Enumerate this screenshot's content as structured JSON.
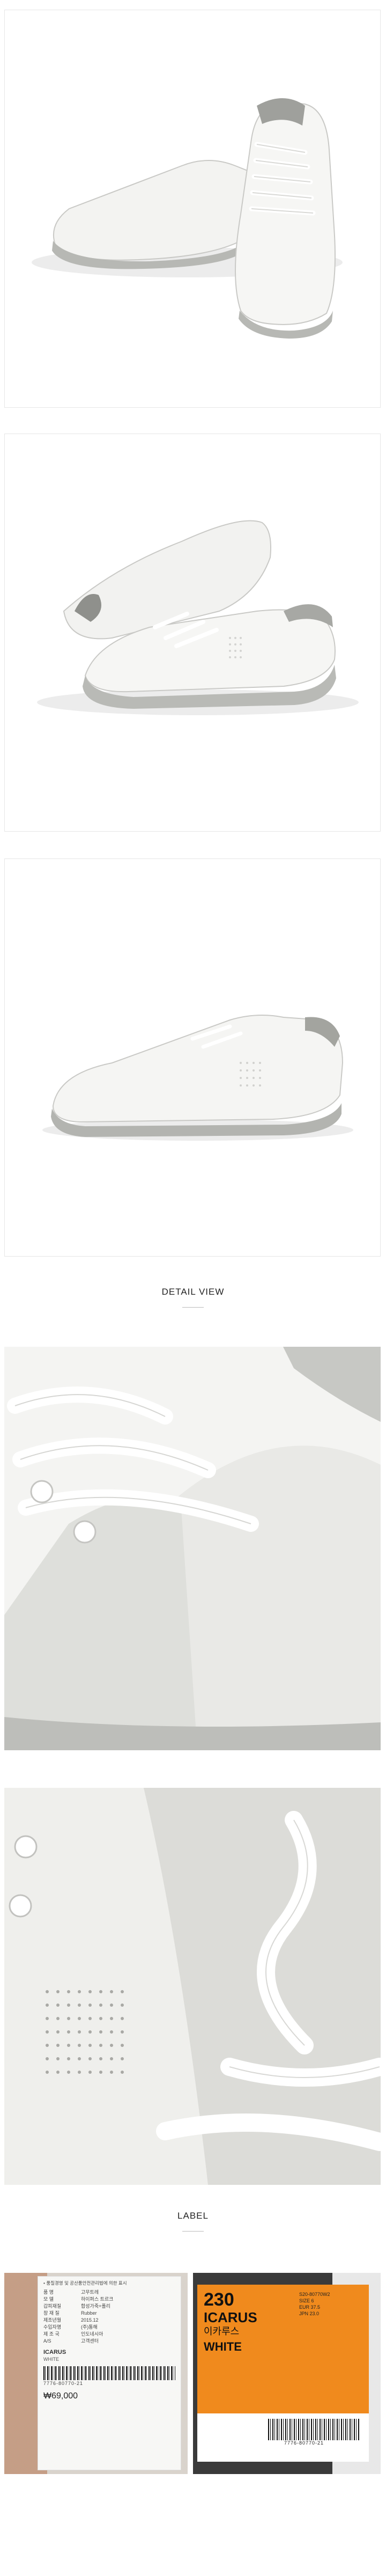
{
  "sections": {
    "detail_view": "DETAIL VIEW",
    "label": "LABEL"
  },
  "tag_left": {
    "header": "• 품질경영 및 공산품안전관리법에 의한 표시",
    "rows": [
      {
        "k": "품  명",
        "v": "고무트레"
      },
      {
        "k": "모  델",
        "v": "하이퍼스 트르크"
      },
      {
        "k": "갑피재질",
        "v": "합성가죽+폴리"
      },
      {
        "k": "창 재 질",
        "v": "Rubber"
      },
      {
        "k": "제조년월",
        "v": "2015.12"
      },
      {
        "k": "수입자명",
        "v": "(주)통해"
      },
      {
        "k": "제 조 국",
        "v": "인도네시아"
      },
      {
        "k": "A/S",
        "v": "고객센터"
      }
    ],
    "model": "ICARUS",
    "color": "WHITE",
    "barcode_num": "7776-80770-21",
    "price": "₩69,000"
  },
  "tag_right": {
    "size": "230",
    "name_en": "ICARUS",
    "name_kr": "이카루스",
    "color": "WHITE",
    "small_lines": [
      "S20-80770W2",
      "SIZE 6",
      "EUR 37.5",
      "JPN 23.0"
    ],
    "barcode_num": "7776-80770-21"
  },
  "colors": {
    "tag_orange": "#f08a1d",
    "background": "#ffffff",
    "shoe_white": "#f1f1ef",
    "shoe_grey": "#a9aaa6"
  }
}
